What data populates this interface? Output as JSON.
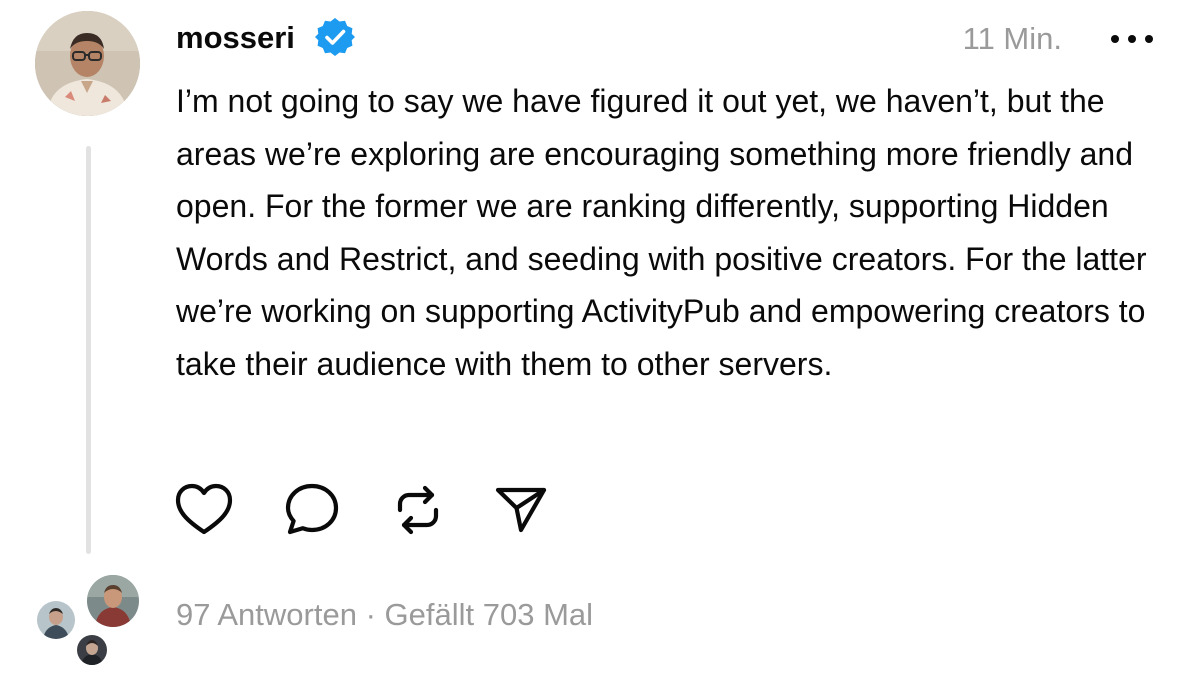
{
  "post": {
    "username": "mosseri",
    "timestamp": "11 Min.",
    "text": "I’m not going to say we have figured it out yet, we haven’t, but the areas we’re exploring are encouraging something more friendly and open. For the former we are ranking differently, supporting Hidden Words and Restrict, and seeding with positive creators. For the latter we’re working on supporting ActivityPub and empowering creators to take their audience with them to other servers."
  },
  "actions": {
    "like_icon": "heart-icon",
    "reply_icon": "comment-icon",
    "repost_icon": "repost-icon",
    "share_icon": "send-icon"
  },
  "stats": {
    "replies": "97 Antworten",
    "separator": "·",
    "likes": "Gefällt 703 Mal"
  },
  "colors": {
    "verified": "#1d9bf0",
    "text": "#0a0a0a",
    "muted": "#9a9a9a",
    "thread_line": "#e2e2e2"
  }
}
